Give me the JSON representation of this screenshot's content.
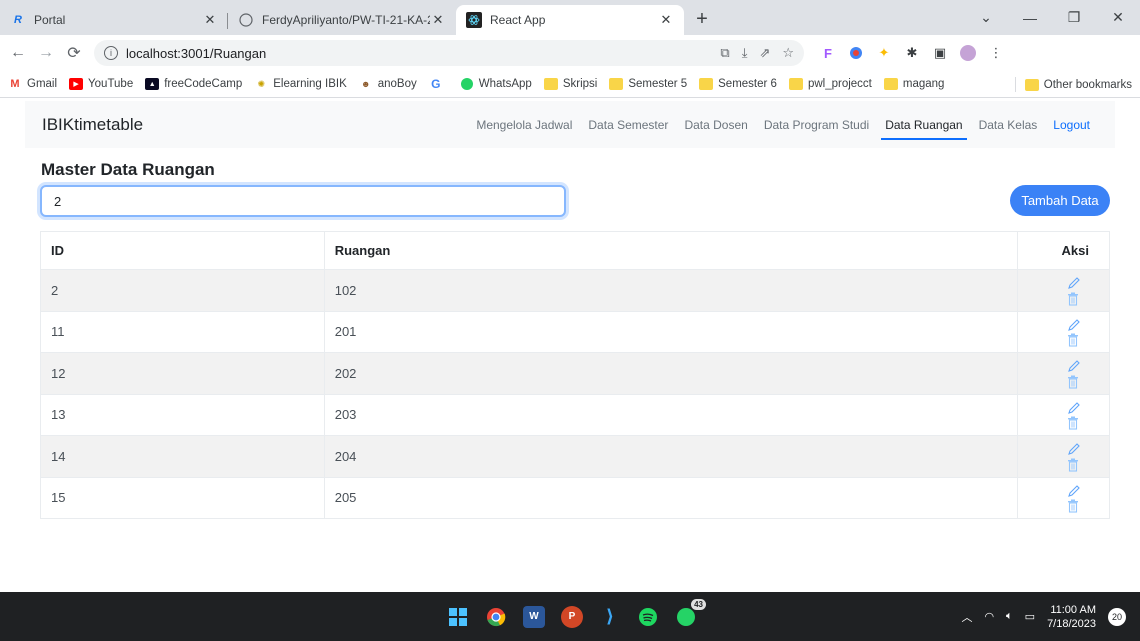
{
  "browser": {
    "tabs": [
      {
        "title": "Portal",
        "favicon": "R"
      },
      {
        "title": "FerdyApriliyanto/PW-TI-21-KA-2",
        "favicon": "github"
      },
      {
        "title": "React App",
        "favicon": "react"
      }
    ],
    "url": "localhost:3001/Ruangan",
    "bookmarks": [
      "Gmail",
      "YouTube",
      "freeCodeCamp",
      "Elearning IBIK",
      "anoBoy",
      "WhatsApp",
      "Skripsi",
      "Semester 5",
      "Semester 6",
      "pwl_projecct",
      "magang"
    ],
    "other_bookmarks": "Other bookmarks"
  },
  "app": {
    "brand": "IBIKtimetable",
    "nav": [
      "Mengelola Jadwal",
      "Data Semester",
      "Data Dosen",
      "Data Program Studi",
      "Data Ruangan",
      "Data Kelas",
      "Logout"
    ],
    "active_nav": "Data Ruangan",
    "heading": "Master Data Ruangan",
    "search_value": "2",
    "add_button": "Tambah Data",
    "table": {
      "headers": [
        "ID",
        "Ruangan",
        "Aksi"
      ],
      "rows": [
        {
          "id": "2",
          "ruangan": "102"
        },
        {
          "id": "11",
          "ruangan": "201"
        },
        {
          "id": "12",
          "ruangan": "202"
        },
        {
          "id": "13",
          "ruangan": "203"
        },
        {
          "id": "14",
          "ruangan": "204"
        },
        {
          "id": "15",
          "ruangan": "205"
        }
      ]
    },
    "colors": {
      "accent": "#3b82f6",
      "edit_icon": "#60a5fa",
      "delete_icon": "#93c5fd"
    }
  },
  "taskbar": {
    "time": "11:00 AM",
    "date": "7/18/2023",
    "whatsapp_badge": "43",
    "notification_count": "20"
  }
}
